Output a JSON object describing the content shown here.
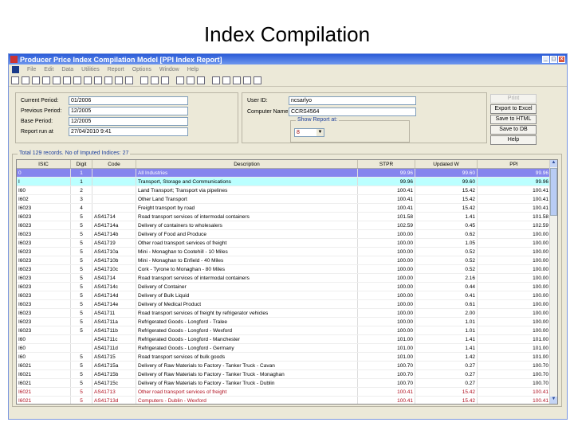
{
  "slide_title": "Index Compilation",
  "window": {
    "title": "Producer Price Index Compilation Model   [PPI Index Report]"
  },
  "menu": [
    "File",
    "Edit",
    "Data",
    "Utilities",
    "Report",
    "Options",
    "Window",
    "Help"
  ],
  "form": {
    "current_period_label": "Current Period:",
    "current_period": "01/2006",
    "previous_period_label": "Previous Period:",
    "previous_period": "12/2005",
    "base_period_label": "Base Period:",
    "base_period": "12/2005",
    "report_run_label": "Report run at",
    "report_run": "27/04/2010     9:41",
    "user_id_label": "User ID:",
    "user_id": "ncsarlyo",
    "computer_name_label": "Computer Name:",
    "computer_name": "CCRS4564",
    "show_report_label": "Show Report at:",
    "show_report_value": "8"
  },
  "buttons": {
    "print": "Print",
    "export": "Export to Excel",
    "html": "Save to HTML",
    "db": "Save to DB",
    "help": "Help"
  },
  "grid": {
    "summary": "Total 129 records. No of Imputed Indices: 27",
    "columns": [
      "ISIC",
      "Digit",
      "Code",
      "Description",
      "STPR",
      "Updated W",
      "PPI"
    ],
    "rows": [
      [
        "0",
        "1",
        "",
        "All Industries",
        "99.96",
        "99.60",
        "99.96"
      ],
      [
        "I",
        "1",
        "",
        "Transport, Storage and Communications",
        "99.96",
        "99.60",
        "99.96"
      ],
      [
        "I60",
        "2",
        "",
        "Land Transport; Transport via pipelines",
        "100.41",
        "15.42",
        "100.41"
      ],
      [
        "I602",
        "3",
        "",
        "Other Land Transport",
        "100.41",
        "15.42",
        "100.41"
      ],
      [
        "I6023",
        "4",
        "",
        "Freight transport by road",
        "100.41",
        "15.42",
        "100.41"
      ],
      [
        "I6023",
        "5",
        "AS41714",
        "Road transport services of intermodal containers",
        "101.58",
        "1.41",
        "101.58"
      ],
      [
        "I6023",
        "5",
        "AS41714a",
        "Delivery of containers to wholesalers",
        "102.59",
        "0.45",
        "102.59"
      ],
      [
        "I6023",
        "5",
        "AS41714b",
        "Delivery of Food and Produce",
        "100.00",
        "0.62",
        "100.00"
      ],
      [
        "I6023",
        "5",
        "AS41719",
        "Other road transport services of freight",
        "100.00",
        "1.05",
        "100.00"
      ],
      [
        "I6023",
        "5",
        "AS41710a",
        "Mini - Monaghan to Cootehill - 10 Miles",
        "100.00",
        "0.52",
        "100.00"
      ],
      [
        "I6023",
        "5",
        "AS41710b",
        "Mini - Monaghan to Enfield - 40 Miles",
        "100.00",
        "0.52",
        "100.00"
      ],
      [
        "I6023",
        "5",
        "AS41710c",
        "Cork - Tyrone to Monaghan - 80 Miles",
        "100.00",
        "0.52",
        "100.00"
      ],
      [
        "I6023",
        "5",
        "AS41714",
        "Road transport services of intermodal containers",
        "100.00",
        "2.16",
        "100.00"
      ],
      [
        "I6023",
        "5",
        "AS41714c",
        "Delivery of Container",
        "100.00",
        "0.44",
        "100.00"
      ],
      [
        "I6023",
        "5",
        "AS41714d",
        "Delivery of Bulk Liquid",
        "100.00",
        "0.41",
        "100.00"
      ],
      [
        "I6023",
        "5",
        "AS41714e",
        "Delivery of Medical Product",
        "100.00",
        "0.61",
        "100.00"
      ],
      [
        "I6023",
        "5",
        "AS41711",
        "Road transport services of freight by refrigerator vehicles",
        "100.00",
        "2.00",
        "100.00"
      ],
      [
        "I6023",
        "5",
        "AS41711a",
        "Refrigerated Goods - Longford - Tralee",
        "100.00",
        "1.01",
        "100.00"
      ],
      [
        "I6023",
        "5",
        "AS41711b",
        "Refrigerated Goods - Longford - Wexford",
        "100.00",
        "1.01",
        "100.00"
      ],
      [
        "I60",
        "",
        "AS41711c",
        "Refrigerated Goods - Longford - Manchester",
        "101.00",
        "1.41",
        "101.00"
      ],
      [
        "I60",
        "",
        "AS41711d",
        "Refrigerated Goods - Longford - Germany",
        "101.00",
        "1.41",
        "101.00"
      ],
      [
        "I60",
        "5",
        "AS41715",
        "Road transport services of bulk goods",
        "101.00",
        "1.42",
        "101.00"
      ],
      [
        "I6021",
        "5",
        "AS41715a",
        "Delivery of Raw Materials to Factory - Tanker Truck - Cavan",
        "100.70",
        "0.27",
        "100.70"
      ],
      [
        "I6021",
        "5",
        "AS41715b",
        "Delivery of Raw Materials to Factory - Tanker Truck - Monaghan",
        "100.70",
        "0.27",
        "100.70"
      ],
      [
        "I6021",
        "5",
        "AS41715c",
        "Delivery of Raw Materials to Factory - Tanker Truck - Dublin",
        "100.70",
        "0.27",
        "100.70"
      ],
      [
        "I6021",
        "5",
        "AS41713",
        "Other road transport services of freight",
        "100.41",
        "15.42",
        "100.41"
      ],
      [
        "I6021",
        "5",
        "AS41713d",
        "Computers - Dublin - Wexford",
        "100.41",
        "15.42",
        "100.41"
      ]
    ],
    "selected_row": 0,
    "highlight_row": 1,
    "red_rows": [
      25,
      26
    ]
  }
}
